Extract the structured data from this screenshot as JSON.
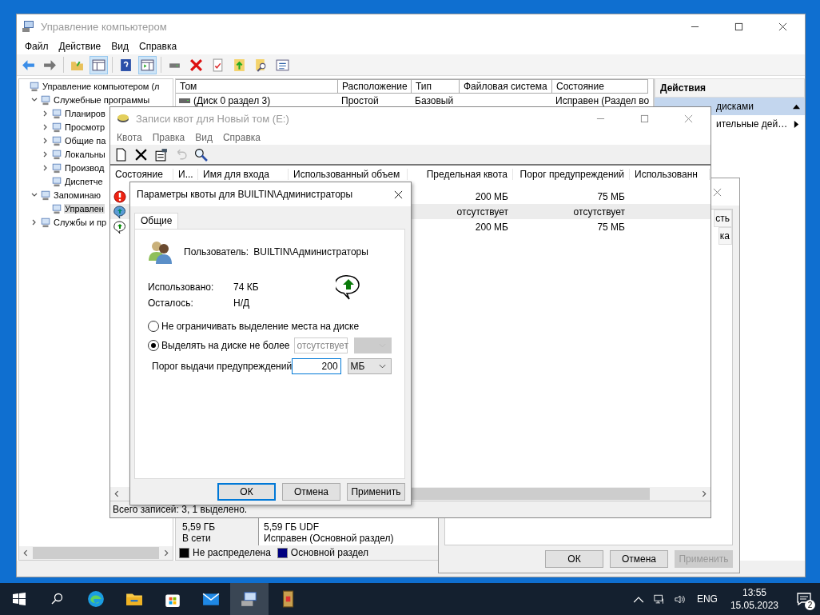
{
  "computer_management": {
    "title": "Управление компьютером",
    "menu": [
      "Файл",
      "Действие",
      "Вид",
      "Справка"
    ],
    "tree": [
      {
        "label": "Управление компьютером (л",
        "selected": false,
        "children": [
          {
            "label": "Служебные программы",
            "expanded": true,
            "selected": false,
            "children": [
              {
                "label": "Планиров",
                "expanded": false,
                "selected": false
              },
              {
                "label": "Просмотр",
                "expanded": false,
                "selected": false
              },
              {
                "label": "Общие па",
                "expanded": false,
                "selected": false
              },
              {
                "label": "Локальны",
                "expanded": false,
                "selected": false
              },
              {
                "label": "Производ",
                "expanded": false,
                "selected": false
              },
              {
                "label": "Диспетче",
                "selected": false
              }
            ]
          },
          {
            "label": "Запоминаю",
            "expanded": true,
            "selected": false,
            "children": [
              {
                "label": "Управлен",
                "selected": true
              }
            ]
          },
          {
            "label": "Службы и пр",
            "expanded": false,
            "selected": false
          }
        ]
      }
    ],
    "volume_columns": [
      "Том",
      "Расположение",
      "Тип",
      "Файловая система",
      "Состояние"
    ],
    "volume_rows": [
      {
        "volume": "(Диск 0 раздел 3)",
        "layout": "Простой",
        "type": "Базовый",
        "status": "Исправен (Раздел во"
      }
    ],
    "disk": {
      "size": "5,59 ГБ",
      "state": "В сети",
      "partition_size": "5,59 ГБ UDF",
      "partition_status": "Исправен (Основной раздел)"
    },
    "legend": [
      {
        "label": "Не распределена",
        "color": "#000000"
      },
      {
        "label": "Основной раздел",
        "color": "#000080"
      }
    ],
    "actions": {
      "title": "Действия",
      "items": [
        {
          "label": "дисками",
          "kind": "group"
        },
        {
          "label": "ительные дей…",
          "kind": "submenu"
        }
      ]
    }
  },
  "properties_dialog": {
    "header_fragments": [
      "сть",
      "ка"
    ],
    "buttons": [
      {
        "label": "ОК",
        "disabled": false
      },
      {
        "label": "Отмена",
        "disabled": false
      },
      {
        "label": "Применить",
        "disabled": true
      }
    ]
  },
  "quota_window": {
    "title": "Записи квот для Новый том (E:)",
    "menu": [
      "Квота",
      "Правка",
      "Вид",
      "Справка"
    ],
    "columns": [
      "Состояние",
      "И...",
      "Имя для входа",
      "Использованный объем",
      "Предельная квота",
      "Порог предупреждений",
      "Использованн"
    ],
    "rows": [
      {
        "kind": "error",
        "limit": "200 МБ",
        "threshold": "75 МБ",
        "selected": false
      },
      {
        "kind": "warning",
        "limit": "отсутствует",
        "threshold": "отсутствует",
        "selected": true
      },
      {
        "kind": "ok",
        "limit": "200 МБ",
        "threshold": "75 МБ",
        "selected": false
      }
    ],
    "status_bar": "Всего записей: 3, 1 выделено."
  },
  "quota_dialog": {
    "title": "Параметры квоты для BUILTIN\\Администраторы",
    "tabs": [
      {
        "label": "Общие",
        "selected": true
      }
    ],
    "user_label": "Пользователь:",
    "user": "BUILTIN\\Администраторы",
    "used_label": "Использовано:",
    "used": "74 КБ",
    "left_label": "Осталось:",
    "left": "Н/Д",
    "options": [
      {
        "label": "Не ограничивать выделение места на диске",
        "selected": false
      },
      {
        "label": "Выделять на диске не более",
        "selected": true
      }
    ],
    "limit": {
      "value": "отсутствует",
      "disabled": true
    },
    "warning": {
      "label": "Порог выдачи предупреждений",
      "value": "200",
      "unit": "МБ"
    },
    "buttons": [
      {
        "label": "ОК",
        "default": true
      },
      {
        "label": "Отмена",
        "default": false
      },
      {
        "label": "Применить",
        "default": false
      }
    ]
  },
  "taskbar": {
    "apps": [
      {
        "kind": "start",
        "active": false
      },
      {
        "kind": "search",
        "active": false
      },
      {
        "kind": "browser",
        "active": false
      },
      {
        "kind": "folder",
        "active": false
      },
      {
        "kind": "store",
        "active": false
      },
      {
        "kind": "mail",
        "active": false
      },
      {
        "kind": "computer",
        "active": true
      },
      {
        "kind": "book",
        "active": false
      }
    ],
    "language": "ENG",
    "time": "13:55",
    "date": "15.05.2023",
    "notifications": "2"
  }
}
